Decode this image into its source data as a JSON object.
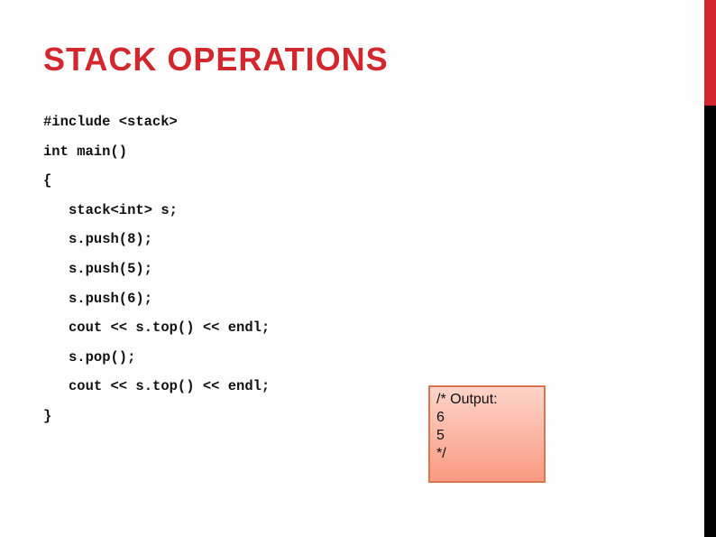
{
  "slide": {
    "title": "STACK OPERATIONS",
    "accent_color": "#d3272e",
    "code_lines": [
      {
        "text": "#include <stack>",
        "indent": false
      },
      {
        "text": "int main()",
        "indent": false
      },
      {
        "text": "{",
        "indent": false
      },
      {
        "text": "stack<int> s;",
        "indent": true
      },
      {
        "text": "s.push(8);",
        "indent": true
      },
      {
        "text": "s.push(5);",
        "indent": true
      },
      {
        "text": "s.push(6);",
        "indent": true
      },
      {
        "text": "cout << s.top() << endl;",
        "indent": true
      },
      {
        "text": "s.pop();",
        "indent": true
      },
      {
        "text": "cout << s.top() << endl;",
        "indent": true
      },
      {
        "text": "}",
        "indent": false
      }
    ],
    "output_box": {
      "lines": [
        "/* Output:",
        "6",
        "5",
        "*/"
      ]
    }
  }
}
